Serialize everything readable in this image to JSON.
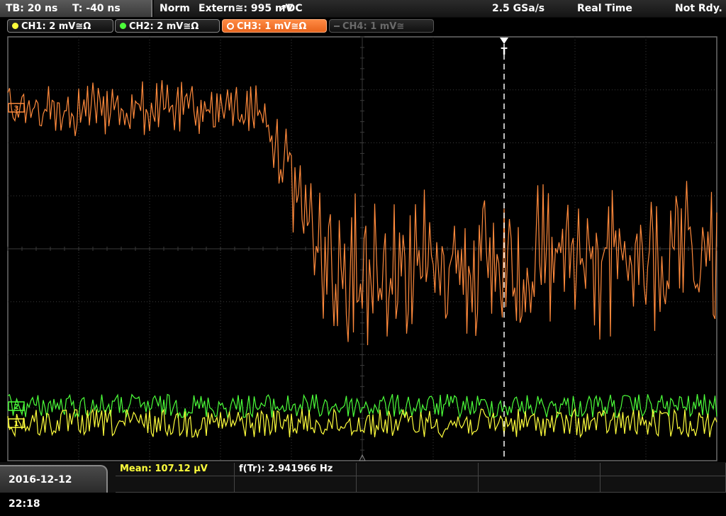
{
  "status": {
    "timebase": "TB: 20 ns",
    "trigger_time": "T: -40 ns",
    "mode": "Norm",
    "trigger_source": "Extern≅: 995 mV",
    "coupling": "↗DC",
    "sample_rate": "2.5 GSa/s",
    "acq_mode": "Real Time",
    "run_state": "Not Rdy."
  },
  "channels": [
    {
      "label": "CH1: 2 mV≅Ω",
      "color": "#ffff3c",
      "state": "on"
    },
    {
      "label": "CH2: 2 mV≅Ω",
      "color": "#4cff3a",
      "state": "on"
    },
    {
      "label": "CH3: 1 mV≅Ω",
      "color": "#ff8a3c",
      "state": "selected"
    },
    {
      "label": "CH4: 1 mV≅",
      "color": "#6a6a6a",
      "state": "off"
    }
  ],
  "markers": {
    "trigger_label": "T",
    "ch3_label": "3",
    "ch2_label": "2",
    "ch1_label": "1"
  },
  "measurements": {
    "mean": "Mean: 107.12 µV",
    "frequency": "f(Tr): 2.941966 Hz"
  },
  "datetime": "2016-12-12 22:18",
  "colors": {
    "ch1": "#ffff3c",
    "ch2": "#4cff3a",
    "ch3": "#ff8a3c",
    "grid": "#3a3a3a"
  }
}
